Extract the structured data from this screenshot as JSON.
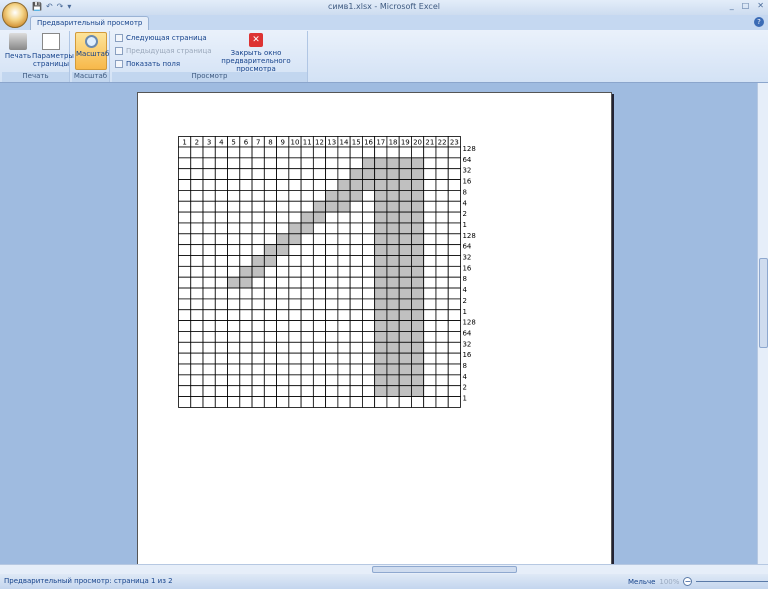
{
  "window": {
    "title": "симв1.xlsx - Microsoft Excel"
  },
  "qat": {
    "save": "💾",
    "undo": "↶",
    "redo": "↷",
    "customize": "▾"
  },
  "tabs": [
    {
      "label": "Предварительный просмотр",
      "active": true
    }
  ],
  "ribbon": {
    "groups": [
      {
        "label": "Печать",
        "buttons": [
          {
            "label": "Печать"
          },
          {
            "label": "Параметры страницы"
          }
        ]
      },
      {
        "label": "Масштаб",
        "buttons": [
          {
            "label": "Масштаб",
            "active": true
          }
        ]
      },
      {
        "label": "Просмотр",
        "items": [
          {
            "label": "Следующая страница",
            "enabled": true
          },
          {
            "label": "Предыдущая страница",
            "enabled": false
          },
          {
            "label": "Показать поля",
            "enabled": true
          }
        ],
        "close": "Закрыть окно предварительного просмотра"
      }
    ]
  },
  "sheet": {
    "columns": [
      "1",
      "2",
      "3",
      "4",
      "5",
      "6",
      "7",
      "8",
      "9",
      "10",
      "11",
      "12",
      "13",
      "14",
      "15",
      "16",
      "17",
      "18",
      "19",
      "20",
      "21",
      "22",
      "23"
    ],
    "row_labels": [
      "128",
      "64",
      "32",
      "16",
      "8",
      "4",
      "2",
      "1",
      "128",
      "64",
      "32",
      "16",
      "8",
      "4",
      "2",
      "1",
      "128",
      "64",
      "32",
      "16",
      "8",
      "4",
      "2",
      "1"
    ],
    "filled": [
      [],
      [
        16,
        17,
        18,
        19,
        20
      ],
      [
        15,
        16,
        17,
        18,
        19,
        20
      ],
      [
        14,
        15,
        16,
        17,
        18,
        19,
        20
      ],
      [
        13,
        14,
        15,
        17,
        18,
        19,
        20
      ],
      [
        12,
        13,
        14,
        17,
        18,
        19,
        20
      ],
      [
        11,
        12,
        17,
        18,
        19,
        20
      ],
      [
        10,
        11,
        17,
        18,
        19,
        20
      ],
      [
        9,
        10,
        17,
        18,
        19,
        20
      ],
      [
        8,
        9,
        17,
        18,
        19,
        20
      ],
      [
        7,
        8,
        17,
        18,
        19,
        20
      ],
      [
        6,
        7,
        17,
        18,
        19,
        20
      ],
      [
        5,
        6,
        17,
        18,
        19,
        20
      ],
      [
        17,
        18,
        19,
        20
      ],
      [
        17,
        18,
        19,
        20
      ],
      [
        17,
        18,
        19,
        20
      ],
      [
        17,
        18,
        19,
        20
      ],
      [
        17,
        18,
        19,
        20
      ],
      [
        17,
        18,
        19,
        20
      ],
      [
        17,
        18,
        19,
        20
      ],
      [
        17,
        18,
        19,
        20
      ],
      [
        17,
        18,
        19,
        20
      ],
      [
        17,
        18,
        19,
        20
      ],
      []
    ],
    "fill_color": "#c0c0c0"
  },
  "status": {
    "text": "Предварительный просмотр: страница 1 из 2",
    "zoom_label": "Мельче",
    "zoom_value": "100%"
  }
}
